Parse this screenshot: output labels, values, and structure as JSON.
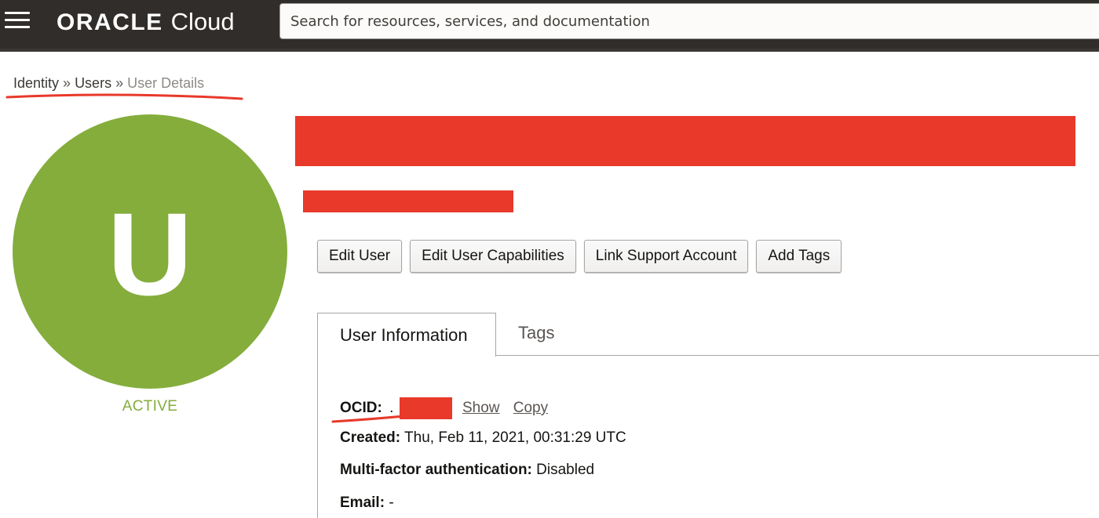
{
  "header": {
    "menu_icon": "hamburger-icon",
    "logo_brand": "ORACLE",
    "logo_product": "Cloud",
    "search_placeholder": "Search for resources, services, and documentation"
  },
  "breadcrumb": {
    "items": [
      "Identity",
      "Users"
    ],
    "separator": "»",
    "current": "User Details"
  },
  "user": {
    "avatar_letter": "U",
    "status": "ACTIVE"
  },
  "actions": {
    "edit_user": "Edit User",
    "edit_capabilities": "Edit User Capabilities",
    "link_support": "Link Support Account",
    "add_tags": "Add Tags"
  },
  "tabs": [
    {
      "label": "User Information",
      "active": true
    },
    {
      "label": "Tags",
      "active": false
    }
  ],
  "details": {
    "ocid_label": "OCID:",
    "ocid_value": ".",
    "show_link": "Show",
    "copy_link": "Copy",
    "created_label": "Created:",
    "created_value": "Thu, Feb 11, 2021, 00:31:29 UTC",
    "mfa_label": "Multi-factor authentication:",
    "mfa_value": "Disabled",
    "email_label": "Email:",
    "email_value": "-"
  },
  "colors": {
    "header_bg": "#312d2a",
    "avatar_green": "#84ad3c",
    "redaction_red": "#e8392a"
  }
}
